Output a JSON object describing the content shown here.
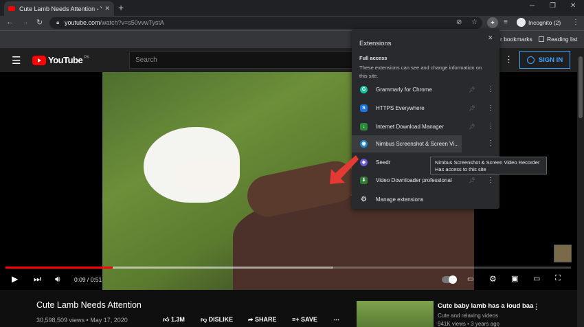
{
  "browser": {
    "tab_title": "Cute Lamb Needs Attention - Yo",
    "url_domain": "youtube.com",
    "url_path": "/watch?v=s50vvwTystA",
    "profile": "Incognito (2)",
    "bookmarks": [
      "r bookmarks",
      "Reading list"
    ]
  },
  "youtube": {
    "logo": "YouTube",
    "country": "PK",
    "search_placeholder": "Search",
    "sign_in": "SIGN IN"
  },
  "player": {
    "time": "0:09 / 0:51",
    "progress_played": 0.19,
    "progress_buffered": 0.58
  },
  "video": {
    "title": "Cute Lamb Needs Attention",
    "meta": "30,598,509 views • May 17, 2020",
    "likes": "1.3M",
    "dislike": "DISLIKE",
    "share": "SHARE",
    "save": "SAVE"
  },
  "recommendation": {
    "title": "Cute baby lamb has a loud baa",
    "channel": "Cute and relaxing videos",
    "views": "941K views • 3 years ago"
  },
  "extensions_popup": {
    "title": "Extensions",
    "section": "Full access",
    "description": "These extensions can see and change information on this site.",
    "items": [
      {
        "name": "Grammarly for Chrome",
        "icon": "grammarly-icon",
        "color": "#15c39a"
      },
      {
        "name": "HTTPS Everywhere",
        "icon": "https-everywhere-icon",
        "color": "#1a73e8"
      },
      {
        "name": "Internet Download Manager",
        "icon": "idm-icon",
        "color": "#2a8a3a"
      },
      {
        "name": "Nimbus Screenshot & Screen Vi...",
        "icon": "nimbus-icon",
        "color": "#1e88c7"
      },
      {
        "name": "Seedr",
        "icon": "seedr-icon",
        "color": "#6b5bd2"
      },
      {
        "name": "Video Downloader professional",
        "icon": "video-downloader-icon",
        "color": "#2e7d32"
      }
    ],
    "manage": "Manage extensions"
  },
  "tooltip": {
    "line1": "Nimbus Screenshot & Screen Video Recorder",
    "line2": "Has access to this site"
  },
  "colors": {
    "accent": "#3ea6ff",
    "progress": "#ff0000",
    "annotation_arrow": "#e53935"
  }
}
